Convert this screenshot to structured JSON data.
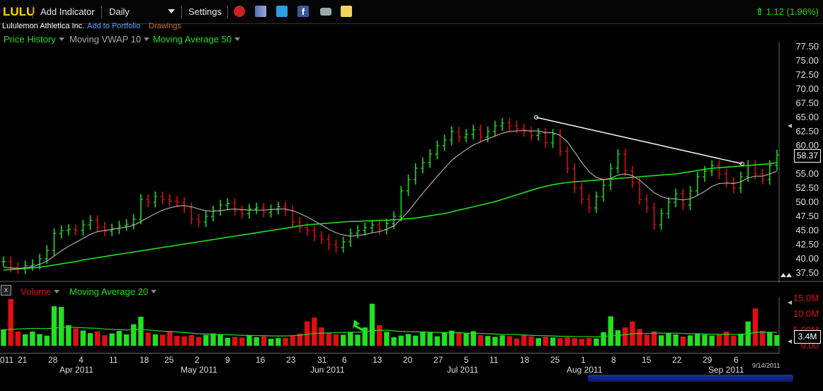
{
  "toolbar": {
    "symbol": "LULU",
    "add_indicator": "Add Indicator",
    "interval": "Daily",
    "settings": "Settings",
    "change": "1.12 (1.96%)",
    "icons": [
      "alarm-clock-icon",
      "books-icon",
      "twitter-icon",
      "facebook-icon",
      "camera-icon",
      "note-icon"
    ]
  },
  "subheader": {
    "company": "Lululemon Athletica Inc.",
    "add_to_portfolio": "Add to Portfolio",
    "drawings": "Drawings"
  },
  "legend": {
    "price_history": "Price History",
    "vwap": "Moving VWAP 10",
    "ma50": "Moving Average 50"
  },
  "volume_legend": {
    "close": "x",
    "volume": "Volume",
    "ma20": "Moving Average 20"
  },
  "price_axis": [
    "77.50",
    "75.00",
    "72.50",
    "70.00",
    "67.50",
    "65.00",
    "62.50",
    "60.00",
    "57.50",
    "55.00",
    "52.50",
    "50.00",
    "47.50",
    "45.00",
    "42.50",
    "40.00",
    "37.50"
  ],
  "last_price": "58.37",
  "volume_axis": [
    "15.0M",
    "10.0M",
    "5.00M",
    "0.00"
  ],
  "last_volume": "3.4M",
  "x_days": [
    "011",
    "21",
    "28",
    "4",
    "11",
    "18",
    "25",
    "2",
    "9",
    "16",
    "23",
    "31",
    "6",
    "13",
    "20",
    "27",
    "5",
    "11",
    "18",
    "25",
    "1",
    "8",
    "15",
    "22",
    "29",
    "6"
  ],
  "x_months": [
    "Apr 2011",
    "May 2011",
    "Jun 2011",
    "Jul 2011",
    "Aug 2011",
    "Sep 2011"
  ],
  "date_stamp": "9/14/2011",
  "colors": {
    "up": "#22e022",
    "down": "#e01010",
    "ma50": "#22dd22",
    "vwap": "#aaaaaa",
    "accent": "#ffd400"
  },
  "chart_data": {
    "type": "bar",
    "title": "",
    "ylim": [
      37.5,
      77.5
    ],
    "close": [
      39.5,
      38.5,
      38.2,
      38.8,
      39.0,
      40.0,
      41.5,
      44.5,
      45.0,
      45.2,
      45.0,
      46.0,
      46.8,
      45.6,
      44.9,
      45.3,
      45.8,
      46.1,
      47.0,
      50.5,
      50.0,
      51.0,
      50.5,
      50.2,
      50.0,
      49.0,
      47.0,
      46.5,
      47.5,
      48.5,
      49.5,
      49.8,
      48.5,
      48.0,
      48.8,
      49.0,
      48.2,
      48.7,
      49.2,
      48.5,
      46.5,
      45.5,
      45.0,
      44.0,
      43.5,
      42.5,
      42.0,
      43.0,
      44.5,
      45.0,
      45.5,
      46.0,
      45.2,
      46.2,
      47.5,
      52.0,
      54.0,
      56.0,
      57.0,
      58.5,
      60.0,
      61.0,
      62.5,
      61.5,
      62.0,
      62.8,
      61.5,
      62.5,
      63.5,
      64.0,
      63.5,
      63.0,
      62.5,
      61.8,
      62.2,
      60.5,
      62.0,
      59.0,
      56.0,
      52.5,
      50.5,
      49.0,
      51.0,
      53.0,
      56.0,
      58.5,
      55.5,
      53.5,
      50.5,
      49.0,
      46.0,
      48.0,
      50.0,
      51.5,
      49.5,
      52.0,
      54.5,
      55.5,
      56.5,
      55.0,
      53.5,
      52.5,
      54.5,
      56.5,
      55.0,
      54.0,
      56.5,
      58.37
    ],
    "ma50": [
      38.0,
      38.1,
      38.2,
      38.3,
      38.4,
      38.5,
      38.7,
      38.9,
      39.1,
      39.3,
      39.5,
      39.8,
      40.0,
      40.2,
      40.4,
      40.6,
      40.8,
      41.0,
      41.2,
      41.4,
      41.6,
      41.8,
      42.0,
      42.2,
      42.4,
      42.6,
      42.8,
      43.0,
      43.2,
      43.4,
      43.6,
      43.8,
      44.0,
      44.2,
      44.4,
      44.6,
      44.8,
      45.0,
      45.2,
      45.4,
      45.6,
      45.8,
      46.0,
      46.1,
      46.2,
      46.3,
      46.4,
      46.5,
      46.6,
      46.6,
      46.7,
      46.7,
      46.8,
      46.8,
      46.9,
      47.0,
      47.1,
      47.2,
      47.4,
      47.6,
      47.8,
      48.0,
      48.3,
      48.6,
      48.9,
      49.2,
      49.5,
      49.8,
      50.1,
      50.5,
      50.9,
      51.3,
      51.7,
      52.1,
      52.5,
      52.8,
      53.1,
      53.3,
      53.5,
      53.6,
      53.7,
      53.8,
      53.9,
      54.0,
      54.1,
      54.2,
      54.3,
      54.4,
      54.5,
      54.6,
      54.7,
      54.8,
      54.9,
      55.0,
      55.2,
      55.4,
      55.6,
      55.8,
      56.0,
      56.1,
      56.2,
      56.3,
      56.4,
      56.5,
      56.6,
      56.7,
      56.8,
      57.0
    ],
    "vwap": [
      38.5,
      38.4,
      38.3,
      38.4,
      38.6,
      39.0,
      39.6,
      40.5,
      41.4,
      42.2,
      42.9,
      43.6,
      44.3,
      44.8,
      45.0,
      45.2,
      45.4,
      45.6,
      45.9,
      46.6,
      47.3,
      48.0,
      48.6,
      49.0,
      49.3,
      49.4,
      49.2,
      48.8,
      48.5,
      48.4,
      48.5,
      48.7,
      48.8,
      48.7,
      48.6,
      48.6,
      48.6,
      48.7,
      48.8,
      48.8,
      48.5,
      48.0,
      47.4,
      46.7,
      46.0,
      45.2,
      44.6,
      44.2,
      44.0,
      44.1,
      44.3,
      44.6,
      44.8,
      45.2,
      45.8,
      47.0,
      48.4,
      50.0,
      51.6,
      53.1,
      54.6,
      56.0,
      57.4,
      58.4,
      59.3,
      60.1,
      60.7,
      61.2,
      61.7,
      62.2,
      62.5,
      62.6,
      62.7,
      62.6,
      62.6,
      62.3,
      62.3,
      61.8,
      60.7,
      58.9,
      57.0,
      55.4,
      54.4,
      54.0,
      54.2,
      54.8,
      55.0,
      54.7,
      53.9,
      52.8,
      51.7,
      51.0,
      50.6,
      50.6,
      50.4,
      50.6,
      51.2,
      51.9,
      52.8,
      53.3,
      53.4,
      53.3,
      53.6,
      54.3,
      54.6,
      54.6,
      55.0,
      55.5
    ],
    "volume": [
      5.2,
      14.8,
      4.5,
      3.6,
      4.5,
      3.7,
      3.2,
      12.5,
      12.3,
      6.5,
      5.5,
      4.8,
      4.0,
      4.6,
      3.3,
      3.9,
      4.7,
      3.6,
      6.8,
      9.2,
      4.2,
      3.6,
      3.5,
      4.5,
      3.1,
      3.0,
      3.4,
      2.8,
      3.4,
      3.9,
      3.5,
      2.5,
      2.8,
      2.6,
      3.3,
      2.7,
      3.0,
      2.2,
      2.4,
      2.5,
      3.3,
      3.9,
      7.7,
      8.9,
      5.8,
      4.1,
      3.6,
      3.5,
      4.3,
      3.5,
      5.8,
      13.3,
      6.5,
      4.4,
      2.7,
      3.2,
      3.7,
      3.2,
      4.4,
      4.2,
      3.0,
      4.2,
      4.8,
      4.4,
      3.9,
      4.6,
      3.4,
      3.1,
      2.8,
      3.3,
      3.1,
      2.3,
      3.5,
      3.0,
      2.4,
      2.9,
      2.6,
      2.4,
      2.7,
      2.4,
      2.2,
      2.5,
      2.3,
      4.3,
      9.3,
      4.9,
      5.8,
      7.7,
      5.3,
      3.5,
      4.6,
      3.3,
      4.0,
      3.6,
      2.9,
      3.3,
      3.9,
      3.5,
      3.2,
      3.6,
      4.5,
      3.2,
      3.8,
      7.7,
      11.8,
      4.7,
      4.2,
      3.4
    ],
    "volume_ma20": [
      5.0,
      5.2,
      5.3,
      5.4,
      5.5,
      5.5,
      5.4,
      5.6,
      5.8,
      5.9,
      5.8,
      5.7,
      5.6,
      5.5,
      5.3,
      5.2,
      5.1,
      5.0,
      5.1,
      5.2,
      5.0,
      4.8,
      4.6,
      4.5,
      4.4,
      4.2,
      4.0,
      3.8,
      3.7,
      3.7,
      3.6,
      3.5,
      3.4,
      3.3,
      3.3,
      3.2,
      3.2,
      3.1,
      3.1,
      3.1,
      3.2,
      3.3,
      3.6,
      3.9,
      4.0,
      4.1,
      4.1,
      4.2,
      4.3,
      4.3,
      4.4,
      4.8,
      4.9,
      4.9,
      4.7,
      4.5,
      4.5,
      4.4,
      4.4,
      4.3,
      4.2,
      4.2,
      4.1,
      4.1,
      4.0,
      4.0,
      3.9,
      3.8,
      3.7,
      3.6,
      3.6,
      3.5,
      3.4,
      3.3,
      3.2,
      3.2,
      3.1,
      3.0,
      3.0,
      2.9,
      2.9,
      2.9,
      2.8,
      2.9,
      3.2,
      3.3,
      3.5,
      3.8,
      3.9,
      3.9,
      4.0,
      4.0,
      4.0,
      4.0,
      3.9,
      3.8,
      3.8,
      3.7,
      3.7,
      3.6,
      3.7,
      3.6,
      3.6,
      3.8,
      4.2,
      4.3,
      4.3,
      4.2
    ],
    "trendline": {
      "from": [
        0.2,
        65.0
      ],
      "to": [
        0.955,
        56.8
      ]
    }
  }
}
